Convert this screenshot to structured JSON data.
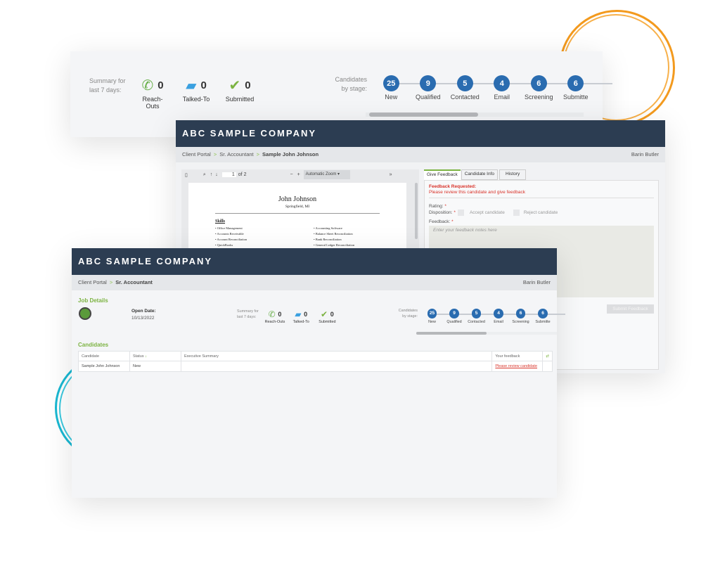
{
  "colors": {
    "accent": "#2a6cb0",
    "header": "#2c3d52",
    "green": "#7cb342",
    "alert": "#d9342b",
    "ring_orange": "#f39a1e",
    "ring_cyan": "#19b8d2"
  },
  "summary": {
    "label": "Summary for last 7 days:",
    "metrics": [
      {
        "icon": "phone-icon",
        "label": "Reach-Outs",
        "count": "0"
      },
      {
        "icon": "chat-icon",
        "label": "Talked-To",
        "count": "0"
      },
      {
        "icon": "submitted-icon",
        "label": "Submitted",
        "count": "0"
      }
    ]
  },
  "stages": {
    "label": "Candidates by stage:",
    "items": [
      {
        "label": "New",
        "count": "25"
      },
      {
        "label": "Qualified",
        "count": "9"
      },
      {
        "label": "Contacted",
        "count": "5"
      },
      {
        "label": "Email",
        "count": "4"
      },
      {
        "label": "Screening",
        "count": "6"
      },
      {
        "label": "Submitte",
        "count": "6"
      }
    ]
  },
  "company": "ABC SAMPLE COMPANY",
  "user": "Barin Butler",
  "feedback_window": {
    "breadcrumb": [
      "Client Portal",
      "Sr. Accountant",
      "Sample John Johnson"
    ],
    "pdf": {
      "page": "1",
      "of": "of 2",
      "zoom": "Automatic Zoom",
      "name": "John Johnson",
      "location": "Springfield, MI",
      "section": "Skills",
      "skills_left": [
        "Office Management",
        "Accounts Receivable",
        "Account Reconciliation",
        "QuickBooks"
      ],
      "skills_right": [
        "Accounting Software",
        "Balance Sheet Reconciliation",
        "Bank Reconciliation",
        "General Ledger Reconciliation"
      ]
    },
    "tabs": [
      "Give Feedback",
      "Candidate Info",
      "History"
    ],
    "alert_title": "Feedback Requested:",
    "alert_text": "Please review this candidate and give feedback",
    "rating_label": "Rating:",
    "disposition_label": "Disposition:",
    "accept": "Accept candidate",
    "reject": "Reject candidate",
    "feedback_label": "Feedback:",
    "feedback_placeholder": "Enter your feedback notes here",
    "submit": "Submit Feedback",
    "required": "*"
  },
  "job_window": {
    "breadcrumb": [
      "Client Portal",
      "Sr. Accountant"
    ],
    "job_details": "Job Details",
    "open_date_label": "Open Date:",
    "open_date": "10/13/2022",
    "candidates_title": "Candidates",
    "columns": [
      "Candidate",
      "Status",
      "Executive Summary",
      "Your feedback"
    ],
    "rows": [
      {
        "candidate": "Sample John Johnson",
        "status": "New",
        "summary": "",
        "feedback": "Please review candidate"
      }
    ]
  }
}
